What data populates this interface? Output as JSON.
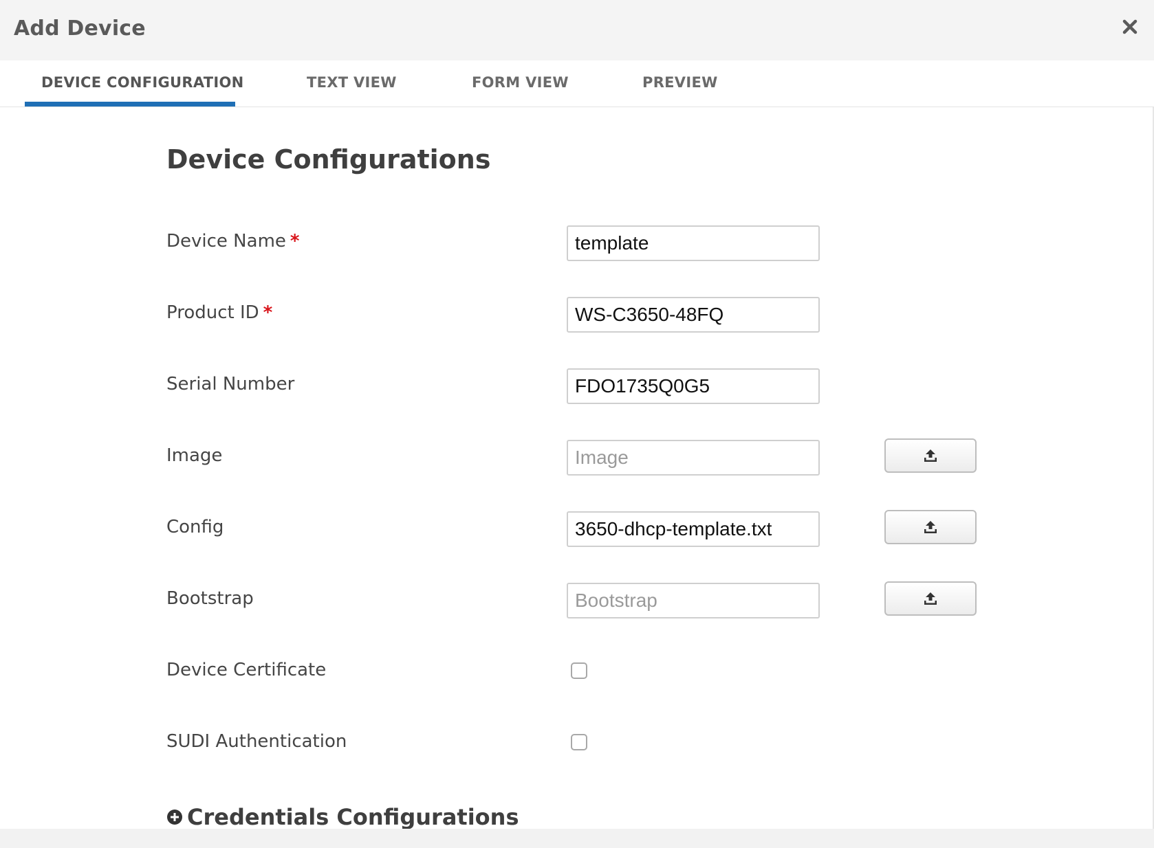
{
  "header": {
    "title": "Add Device"
  },
  "tabs": [
    {
      "label": "DEVICE CONFIGURATION",
      "active": true
    },
    {
      "label": "TEXT VIEW",
      "active": false
    },
    {
      "label": "FORM VIEW",
      "active": false
    },
    {
      "label": "PREVIEW",
      "active": false
    }
  ],
  "form": {
    "title": "Device Configurations",
    "required_marker": "*",
    "device_name": {
      "label": "Device Name",
      "value": "template"
    },
    "product_id": {
      "label": "Product ID",
      "value": "WS-C3650-48FQ"
    },
    "serial_number": {
      "label": "Serial Number",
      "value": "FDO1735Q0G5"
    },
    "image": {
      "label": "Image",
      "value": "",
      "placeholder": "Image"
    },
    "config": {
      "label": "Config",
      "value": "3650-dhcp-template.txt"
    },
    "bootstrap": {
      "label": "Bootstrap",
      "value": "",
      "placeholder": "Bootstrap"
    },
    "device_certificate": {
      "label": "Device Certificate",
      "checked": false
    },
    "sudi_authentication": {
      "label": "SUDI Authentication",
      "checked": false
    }
  },
  "credentials": {
    "label": "Credentials Configurations"
  },
  "icons": {
    "close": "close-icon",
    "upload": "upload-icon",
    "plus": "plus-circle-icon"
  },
  "colors": {
    "accent": "#1f6fb5",
    "required": "#d9151b",
    "header_bg": "#f4f4f4"
  }
}
